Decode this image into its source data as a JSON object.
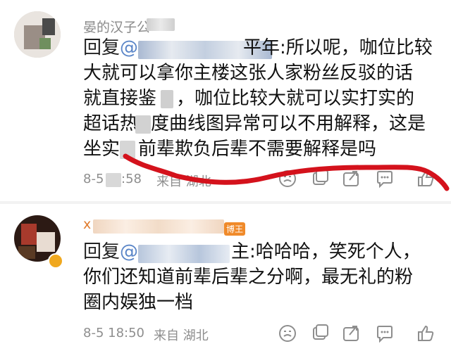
{
  "comments": [
    {
      "name": "晏的汉子公",
      "body_lines": [
        "回复@",
        "平年:所以呢，咖位比较",
        "大就可以拿你主楼这张人家粉丝反驳的话",
        "就直接鉴",
        "，咖位比较大就可以实打实的",
        "超话热",
        "度曲线图异常可以不用解释，这是",
        "坐实",
        "前辈欺负后辈不需要解释是吗"
      ],
      "time": "8-5",
      "time_tail": ":58",
      "location": "来自 湖北",
      "actions": [
        "emoji-icon",
        "copy-icon",
        "share-icon",
        "comment-icon",
        "like-icon"
      ]
    },
    {
      "name": "x",
      "badge": "博王",
      "body_lines": [
        "回复@",
        "主:哈哈哈，笑死个人，",
        "你们还知道前辈后辈之分啊，最无礼的粉",
        "圈内娱独一档"
      ],
      "time": "8-5 18:50",
      "location": "来自 湖北",
      "actions": [
        "emoji-icon",
        "copy-icon",
        "share-icon",
        "comment-icon",
        "like-icon"
      ]
    }
  ],
  "colors": {
    "mention": "#5b86c8",
    "text": "#111111",
    "meta": "#8e8e8e",
    "annotation": "#d4121c",
    "badge": "#f08a2a"
  }
}
